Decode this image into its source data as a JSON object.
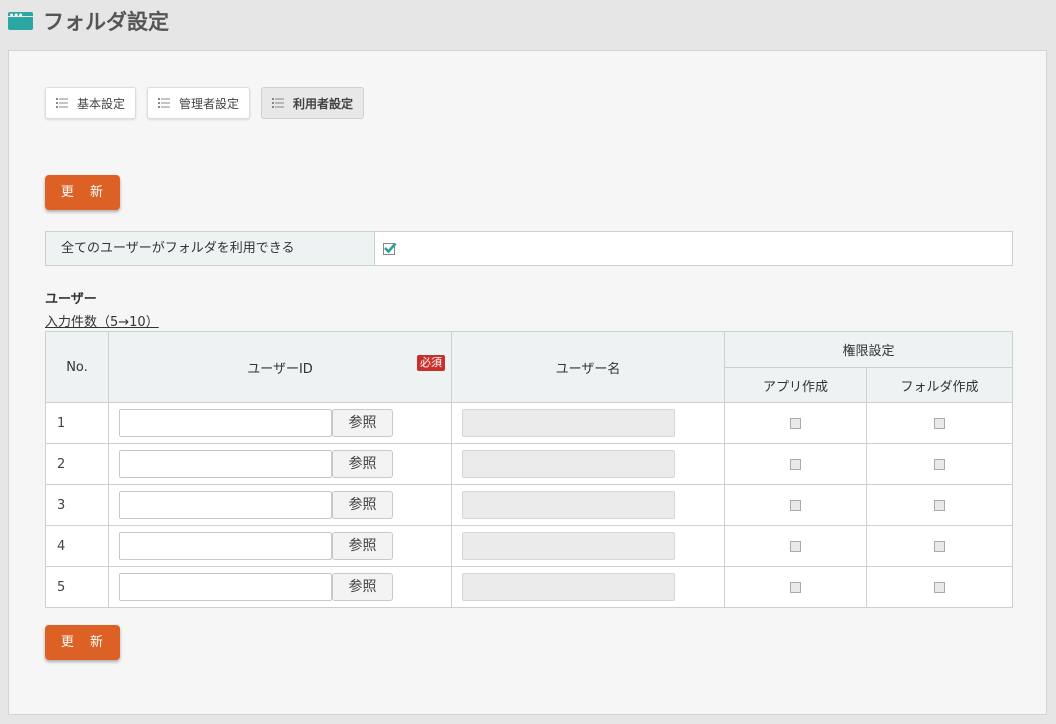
{
  "header": {
    "title": "フォルダ設定",
    "icon": "window-icon"
  },
  "tabs": [
    {
      "label": "基本設定",
      "active": false,
      "icon": "list-icon"
    },
    {
      "label": "管理者設定",
      "active": false,
      "icon": "list-icon"
    },
    {
      "label": "利用者設定",
      "active": true,
      "icon": "list-icon"
    }
  ],
  "actions": {
    "update_label": "更 新"
  },
  "allow_all": {
    "label": "全てのユーザーがフォルダを利用できる",
    "checked": true
  },
  "users_section": {
    "title": "ユーザー",
    "input_count_link": "入力件数（5→10）"
  },
  "table": {
    "headers": {
      "no": "No.",
      "user_id": "ユーザーID",
      "required_badge": "必須",
      "user_name": "ユーザー名",
      "permission": "権限設定",
      "app_create": "アプリ作成",
      "folder_create": "フォルダ作成"
    },
    "reference_button": "参照",
    "rows": [
      {
        "no": "1",
        "user_id": "",
        "user_name": "",
        "app_create": false,
        "folder_create": false
      },
      {
        "no": "2",
        "user_id": "",
        "user_name": "",
        "app_create": false,
        "folder_create": false
      },
      {
        "no": "3",
        "user_id": "",
        "user_name": "",
        "app_create": false,
        "folder_create": false
      },
      {
        "no": "4",
        "user_id": "",
        "user_name": "",
        "app_create": false,
        "folder_create": false
      },
      {
        "no": "5",
        "user_id": "",
        "user_name": "",
        "app_create": false,
        "folder_create": false
      }
    ]
  },
  "colors": {
    "accent_teal": "#2aa6a3",
    "button_orange": "#dd6124",
    "required_red": "#c9302c",
    "header_cell_bg": "#ecf3f2"
  }
}
